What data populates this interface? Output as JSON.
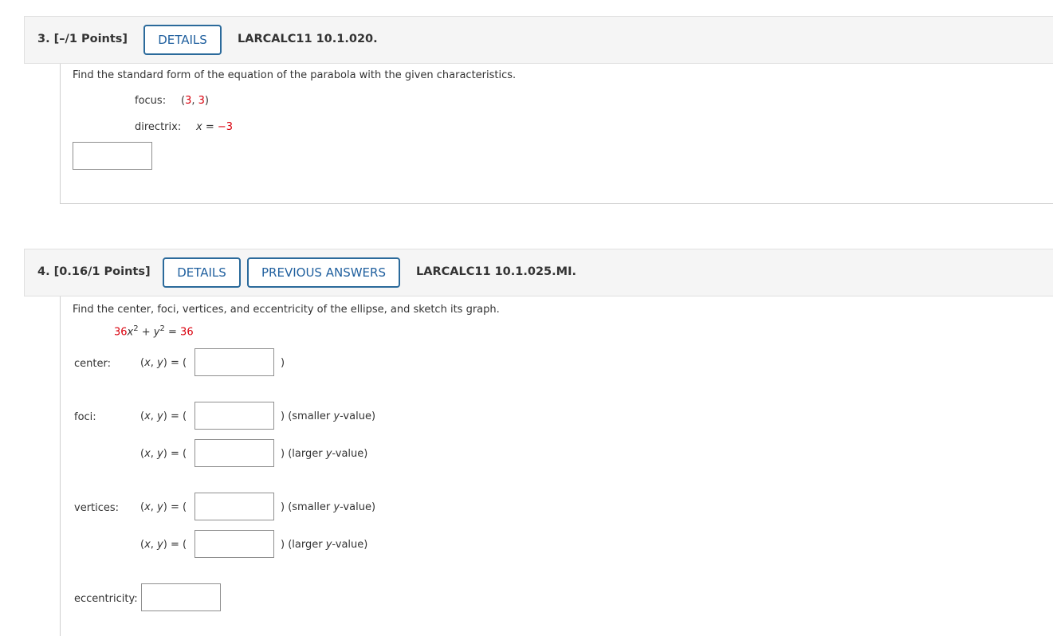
{
  "q3": {
    "number": "3.",
    "points": "[–/1 Points]",
    "details_label": "DETAILS",
    "code": "LARCALC11 10.1.020.",
    "prompt": "Find the standard form of the equation of the parabola with the given characteristics.",
    "focus_label": "focus:",
    "focus_open": "(",
    "focus_x": "3",
    "focus_sep": ", ",
    "focus_y": "3",
    "focus_close": ")",
    "directrix_label": "directrix:",
    "directrix_var": "x",
    "directrix_eq": " = ",
    "directrix_value": "−3",
    "answer_value": ""
  },
  "q4": {
    "number": "4.",
    "points": "[0.16/1 Points]",
    "details_label": "DETAILS",
    "previous_label": "PREVIOUS ANSWERS",
    "code": "LARCALC11 10.1.025.MI.",
    "prompt": "Find the center, foci, vertices, and eccentricity of the ellipse, and sketch its graph.",
    "equation": {
      "coef": "36",
      "x": "x",
      "exp1": "2",
      "plus": " + ",
      "y": "y",
      "exp2": "2",
      "eq": " = ",
      "rhs": "36"
    },
    "xy_prefix_open": "(",
    "xy_x": "x",
    "xy_comma": ", ",
    "xy_y": "y",
    "xy_prefix_close": ") = (",
    "center_label": "center:",
    "foci_label": "foci:",
    "vertices_label": "vertices:",
    "eccentricity_label": "eccentricity:",
    "close_paren": ")",
    "smaller_prefix": ") (smaller ",
    "larger_prefix": ") (larger ",
    "y_var": "y",
    "value_suffix": "-value)",
    "center_value": "",
    "foci_smaller_value": "",
    "foci_larger_value": "",
    "vertices_smaller_value": "",
    "vertices_larger_value": "",
    "eccentricity_value": ""
  }
}
